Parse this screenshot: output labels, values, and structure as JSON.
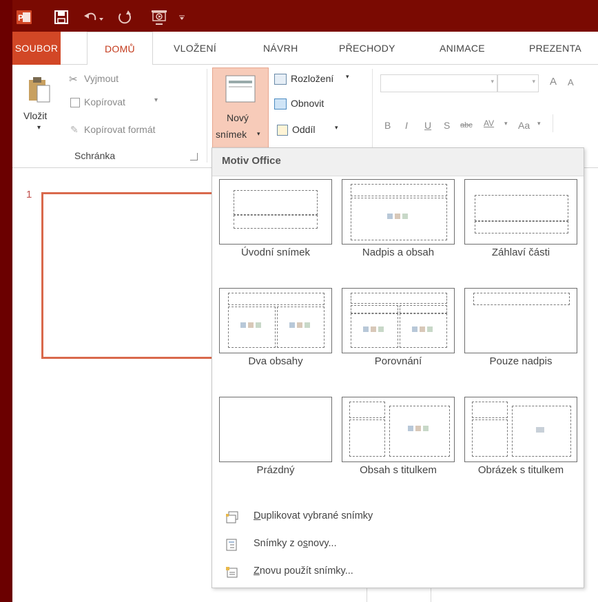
{
  "quick_access": {
    "app_icon": "powerpoint-icon",
    "save_icon": "save-icon",
    "undo_icon": "undo-icon",
    "redo_icon": "redo-icon",
    "present_icon": "start-slideshow-icon",
    "customize_icon": "customize-qat-icon"
  },
  "tabs": {
    "file": "SOUBOR",
    "home": "DOMŮ",
    "insert": "VLOŽENÍ",
    "design": "NÁVRH",
    "transitions": "PŘECHODY",
    "animations": "ANIMACE",
    "slideshow": "PREZENTA"
  },
  "clipboard": {
    "paste": "Vložit",
    "cut": "Vyjmout",
    "copy": "Kopírovat",
    "copy_arrow": "▾",
    "format_painter": "Kopírovat formát",
    "group_label": "Schránka"
  },
  "slides": {
    "new_slide_line1": "Nový",
    "new_slide_line2": "snímek",
    "layout": "Rozložení",
    "reset": "Obnovit",
    "section": "Oddíl"
  },
  "font": {
    "increase": "A",
    "decrease": "A",
    "bold": "B",
    "italic": "I",
    "underline": "U",
    "shadow": "S",
    "strikethrough": "abc",
    "spacing": "AV",
    "case": "Aa"
  },
  "thumbnail": {
    "number": "1"
  },
  "dropdown": {
    "header": "Motiv Office",
    "layouts": [
      {
        "label": "Úvodní snímek"
      },
      {
        "label": "Nadpis a obsah"
      },
      {
        "label": "Záhlaví části"
      },
      {
        "label": "Dva obsahy"
      },
      {
        "label": "Porovnání"
      },
      {
        "label": "Pouze nadpis"
      },
      {
        "label": "Prázdný"
      },
      {
        "label": "Obsah s titulkem"
      },
      {
        "label": "Obrázek s titulkem"
      }
    ],
    "menu": [
      {
        "label_u": "D",
        "label_rest": "uplikovat vybrané snímky"
      },
      {
        "label_pre": "Snímky z o",
        "label_u": "s",
        "label_rest": "novy..."
      },
      {
        "label_u": "Z",
        "label_rest": "novu použít snímky..."
      }
    ]
  },
  "colors": {
    "accent": "#d24726",
    "titlebar": "#7a0a02",
    "background": "#6b0000"
  }
}
